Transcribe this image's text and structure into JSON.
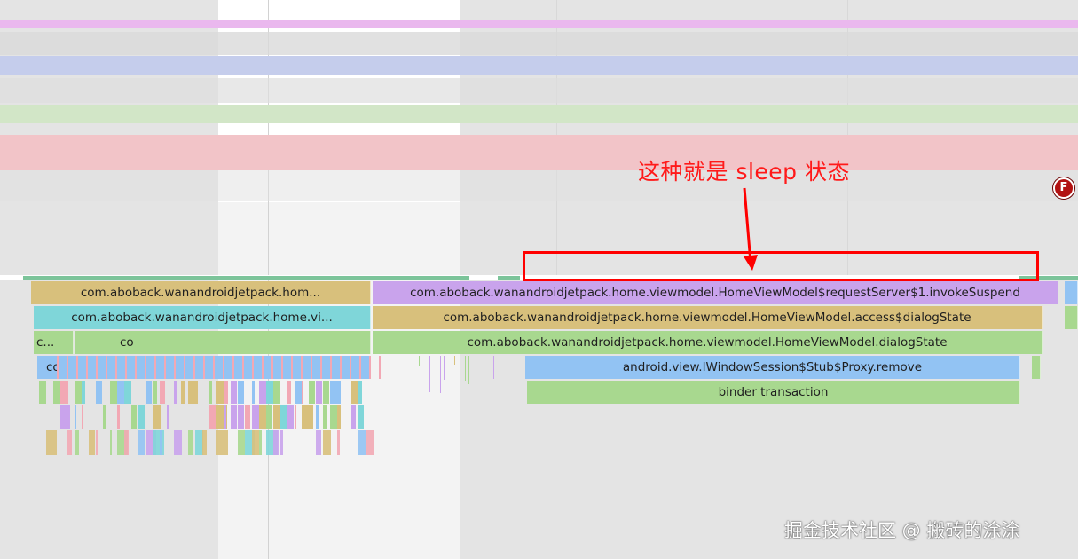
{
  "annotation": {
    "text": "这种就是 sleep 状态",
    "color": "#ff0000"
  },
  "marker": {
    "label": "F"
  },
  "flamegraph": {
    "row1": {
      "left_label": "com.aboback.wanandroidjetpack.hom...",
      "right_label": "com.aboback.wanandroidjetpack.home.viewmodel.HomeViewModel$requestServer$1.invokeSuspend"
    },
    "row2": {
      "left_label": "com.aboback.wanandroidjetpack.home.vi...",
      "right_label": "com.aboback.wanandroidjetpack.home.viewmodel.HomeViewModel.access$dialogState"
    },
    "row3": {
      "left_a": "c...",
      "left_b": "co",
      "right_label": "com.aboback.wanandroidjetpack.home.viewmodel.HomeViewModel.dialogState"
    },
    "row4": {
      "left_label": "co",
      "right_label": "android.view.IWindowSession$Stub$Proxy.remove"
    },
    "row5": {
      "right_label": "binder transaction"
    }
  },
  "colors": {
    "tan": "#d8c07c",
    "purple": "#c9a3ec",
    "cyan": "#7fd6d9",
    "green": "#a8d88f",
    "blue": "#92c3f3"
  },
  "watermark": "掘金技术社区 @ 搬砖的涂涂"
}
